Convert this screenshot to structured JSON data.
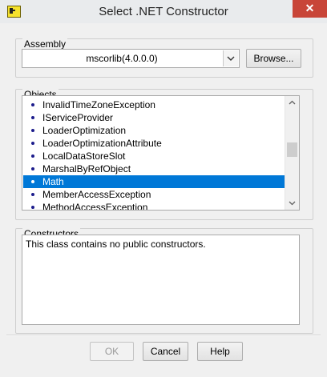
{
  "window": {
    "title": "Select .NET Constructor",
    "close_label": "✕"
  },
  "assembly": {
    "group_label": "Assembly",
    "selected_value": "mscorlib(4.0.0.0)",
    "browse_label": "Browse..."
  },
  "objects": {
    "group_label": "Objects",
    "items": [
      {
        "label": "InvalidTimeZoneException",
        "selected": false
      },
      {
        "label": "IServiceProvider",
        "selected": false
      },
      {
        "label": "LoaderOptimization",
        "selected": false
      },
      {
        "label": "LoaderOptimizationAttribute",
        "selected": false
      },
      {
        "label": "LocalDataStoreSlot",
        "selected": false
      },
      {
        "label": "MarshalByRefObject",
        "selected": false
      },
      {
        "label": "Math",
        "selected": true
      },
      {
        "label": "MemberAccessException",
        "selected": false
      },
      {
        "label": "MethodAccessException",
        "selected": false
      }
    ]
  },
  "constructors": {
    "group_label": "Constructors",
    "text": "This class contains no public constructors."
  },
  "footer": {
    "ok_label": "OK",
    "cancel_label": "Cancel",
    "help_label": "Help"
  }
}
